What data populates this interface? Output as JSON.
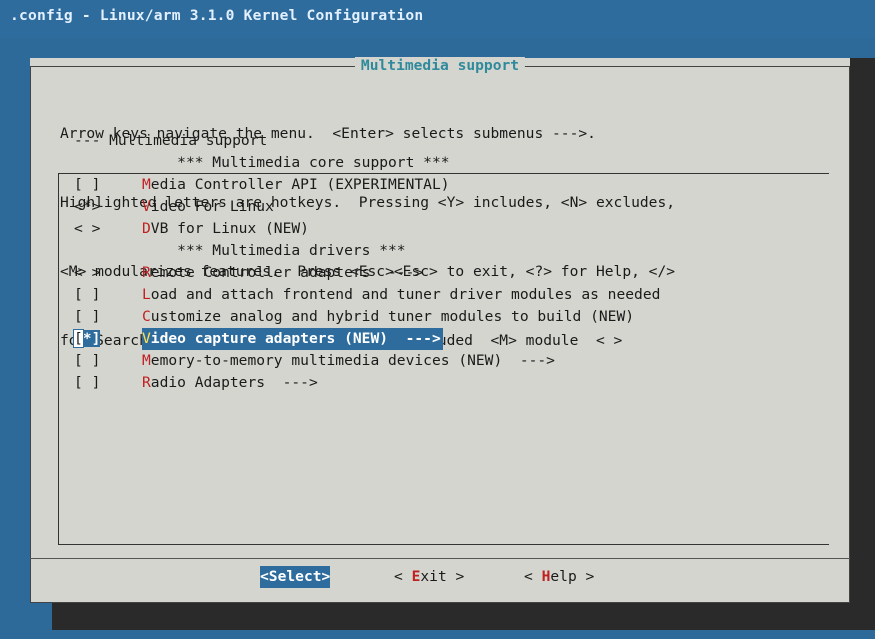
{
  "window": {
    "title": ".config - Linux/arm 3.1.0 Kernel Configuration"
  },
  "dialog": {
    "title": "Multimedia support",
    "help_lines": [
      "Arrow keys navigate the menu.  <Enter> selects submenus --->.",
      "Highlighted letters are hotkeys.  Pressing <Y> includes, <N> excludes,",
      "<M> modularizes features.  Press <Esc><Esc> to exit, <?> for Help, </>",
      "for Search.  Legend: [*] built-in  [ ] excluded  <M> module  < >"
    ]
  },
  "menu": {
    "items": [
      {
        "state": "",
        "pre": "",
        "hotkey": "",
        "rest": "--- Multimedia support",
        "kind": "plain"
      },
      {
        "state": "",
        "pre": "    ",
        "hotkey": "",
        "rest": "*** Multimedia core support ***",
        "kind": "header"
      },
      {
        "state": "[ ]",
        "pre": "",
        "hotkey": "M",
        "rest": "edia Controller API (EXPERIMENTAL)",
        "kind": "item"
      },
      {
        "state": "<*>",
        "pre": "",
        "hotkey": "V",
        "rest": "ideo For Linux",
        "kind": "item"
      },
      {
        "state": "< >",
        "pre": "",
        "hotkey": "D",
        "rest": "VB for Linux (NEW)",
        "kind": "item"
      },
      {
        "state": "",
        "pre": "    ",
        "hotkey": "",
        "rest": "*** Multimedia drivers ***",
        "kind": "header"
      },
      {
        "state": "< >",
        "pre": "",
        "hotkey": "R",
        "rest": "emote Controller adapters  --->",
        "kind": "item"
      },
      {
        "state": "[ ]",
        "pre": "",
        "hotkey": "L",
        "rest": "oad and attach frontend and tuner driver modules as needed",
        "kind": "item"
      },
      {
        "state": "[ ]",
        "pre": "",
        "hotkey": "C",
        "rest": "ustomize analog and hybrid tuner modules to build (NEW)",
        "kind": "item"
      },
      {
        "state": "[*]",
        "pre": "",
        "hotkey": "V",
        "rest": "ideo capture adapters (NEW)  --->",
        "kind": "item",
        "selected": true
      },
      {
        "state": "[ ]",
        "pre": "",
        "hotkey": "M",
        "rest": "emory-to-memory multimedia devices (NEW)  --->",
        "kind": "item"
      },
      {
        "state": "[ ]",
        "pre": "",
        "hotkey": "R",
        "rest": "adio Adapters  --->",
        "kind": "item"
      }
    ]
  },
  "buttons": {
    "select": {
      "open": "<",
      "hotkey": "S",
      "rest": "elect",
      "close": ">"
    },
    "exit": {
      "open": "< ",
      "hotkey": "E",
      "rest": "xit",
      "close": " >"
    },
    "help": {
      "open": "< ",
      "hotkey": "H",
      "rest": "elp",
      "close": " >"
    }
  },
  "colors": {
    "accent": "#2e6c9d",
    "dialog_bg": "#d5d5cf",
    "hotkey": "#c02020",
    "title_text": "#2f8a9c"
  }
}
